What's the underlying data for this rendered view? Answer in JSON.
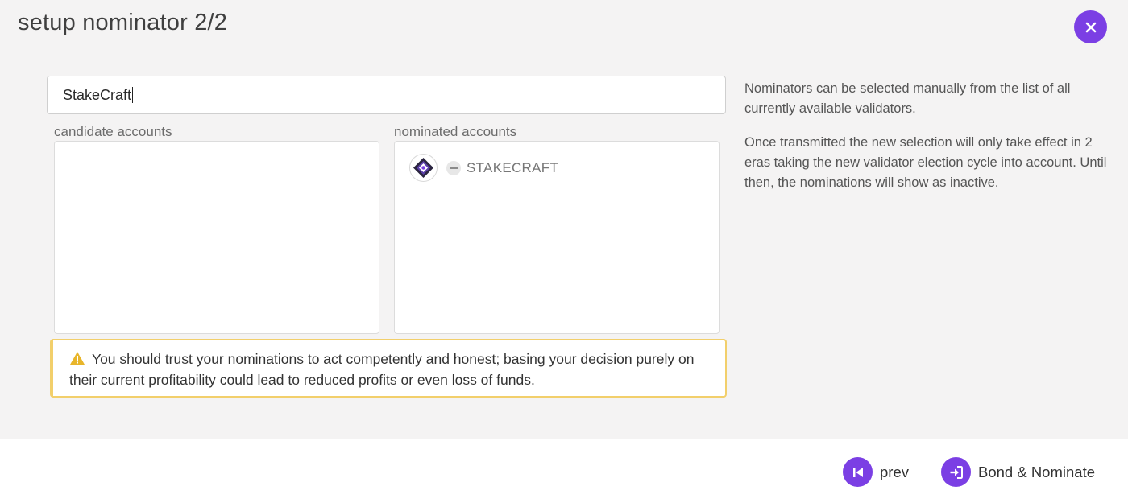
{
  "modal": {
    "title": "setup nominator 2/2"
  },
  "search": {
    "value": "StakeCraft"
  },
  "candidates": {
    "label": "candidate accounts",
    "items": []
  },
  "nominated": {
    "label": "nominated accounts",
    "items": [
      {
        "name": "STAKECRAFT",
        "icon": "validator-identicon"
      }
    ]
  },
  "warning": {
    "icon": "warning-triangle-icon",
    "text": "You should trust your nominations to act competently and honest; basing your decision purely on their current profitability could lead to reduced profits or even loss of funds."
  },
  "help": {
    "paragraph1": "Nominators can be selected manually from the list of all currently available validators.",
    "paragraph2": "Once transmitted the new selection will only take effect in 2 eras taking the new validator election cycle into account. Until then, the nominations will show as inactive."
  },
  "footer": {
    "prev_label": "prev",
    "submit_label": "Bond & Nominate"
  },
  "colors": {
    "accent": "#7b3fe4",
    "warning_border": "#f2cf6b",
    "warning_icon": "#e8b52a"
  }
}
